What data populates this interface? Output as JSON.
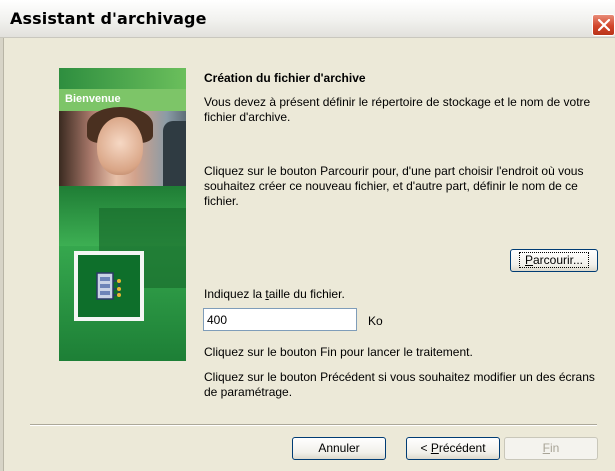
{
  "window": {
    "title": "Assistant d'archivage"
  },
  "panel": {
    "welcome_label": "Bienvenue",
    "icon_name": "archive-icon"
  },
  "content": {
    "heading": "Création du fichier d'archive",
    "intro": "Vous devez à présent définir le répertoire de stockage et le nom de votre fichier d'archive.",
    "browse_instruction": "Cliquez sur le bouton Parcourir pour, d'une part choisir l'endroit où vous souhaitez créer ce nouveau fichier, et d'autre part, définir le nom de ce fichier.",
    "browse_button": {
      "pre": "",
      "accel": "P",
      "post": "arcourir..."
    },
    "size_label": {
      "pre": "Indiquez la ",
      "accel": "t",
      "post": "aille du fichier."
    },
    "size_value": "400",
    "size_unit": "Ko",
    "finish_instruction": "Cliquez sur le bouton Fin pour lancer le traitement.",
    "prev_instruction": "Cliquez sur le bouton Précédent si vous souhaitez modifier un des écrans de paramétrage."
  },
  "footer": {
    "cancel": "Annuler",
    "previous": {
      "pre": "< ",
      "accel": "P",
      "post": "récédent"
    },
    "finish": {
      "pre": "",
      "accel": "F",
      "post": "in"
    }
  },
  "colors": {
    "accent_green": "#1E8A3B",
    "close_red": "#D2452A",
    "dialog_bg": "#ECE9D8"
  }
}
